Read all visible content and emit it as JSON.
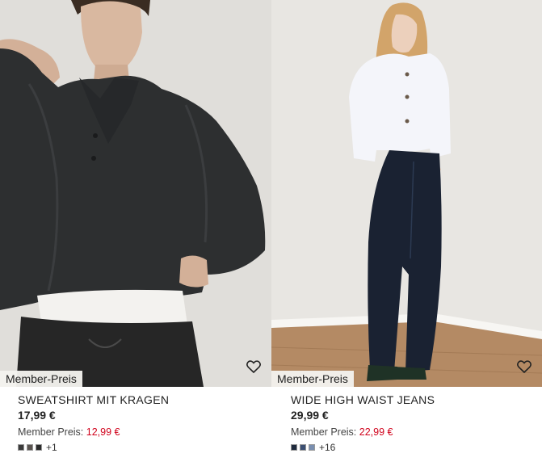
{
  "products": [
    {
      "badge": "Member-Preis",
      "title": "SWEATSHIRT MIT KRAGEN",
      "price": "17,99 €",
      "member_label": "Member Preis:",
      "member_price": "12,99 €",
      "swatches": [
        "#3a3a3a",
        "#5a5450",
        "#2b2b2b"
      ],
      "more_colors": "+1",
      "favorite_icon": "heart-outline-icon"
    },
    {
      "badge": "Member-Preis",
      "title": "WIDE HIGH WAIST JEANS",
      "price": "29,99 €",
      "member_label": "Member Preis:",
      "member_price": "22,99 €",
      "swatches": [
        "#1f2a3d",
        "#3c4f72",
        "#7a8fb0"
      ],
      "more_colors": "+16",
      "favorite_icon": "heart-outline-icon"
    }
  ],
  "colors": {
    "member_price": "#d0021b",
    "badge_bg": "#f4f2ee"
  }
}
